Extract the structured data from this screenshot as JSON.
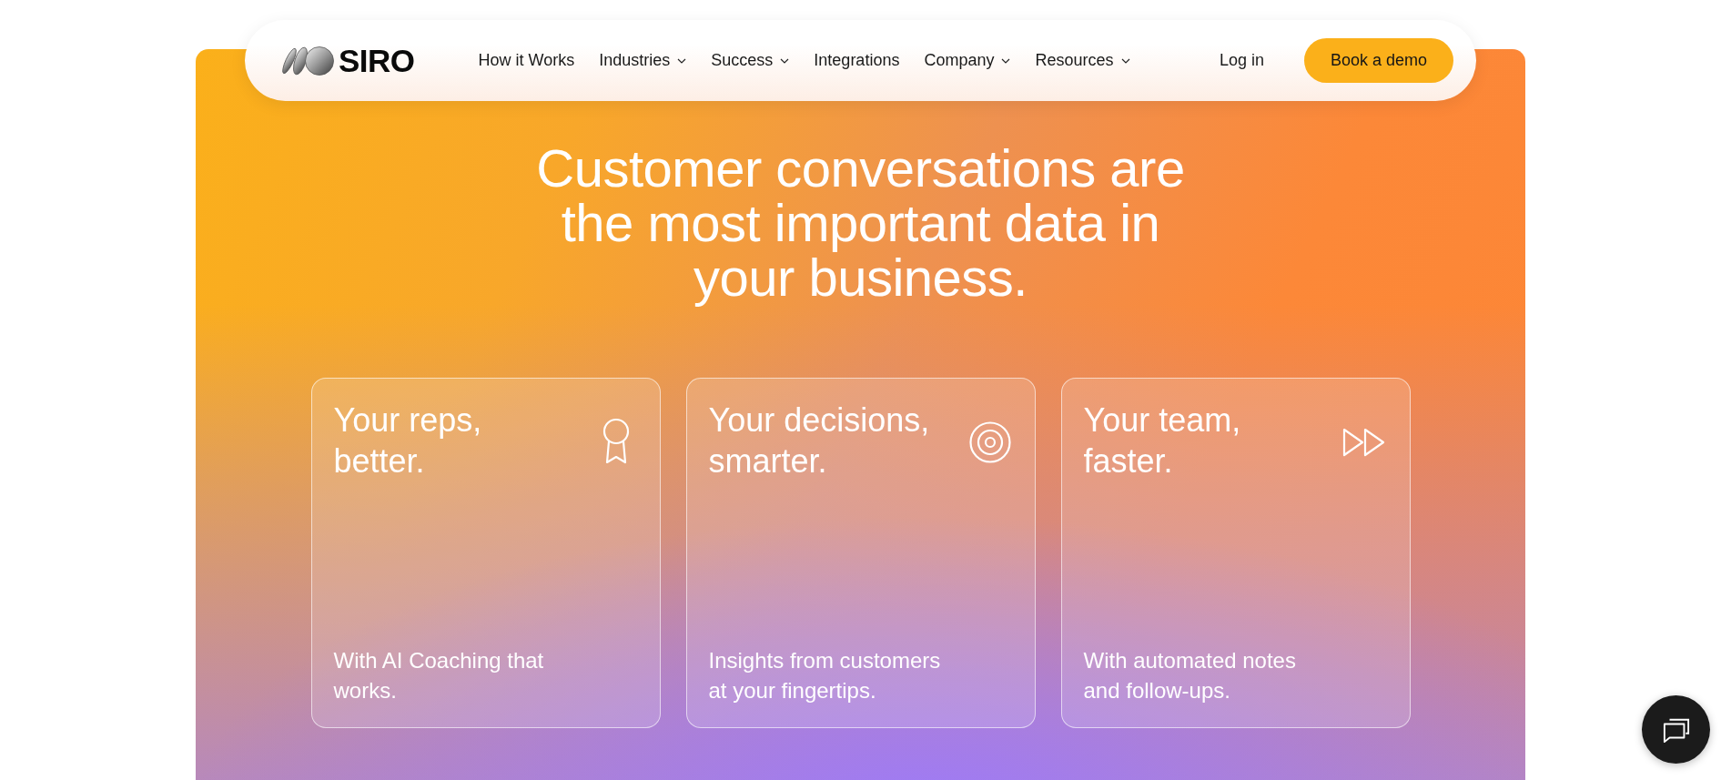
{
  "logo": {
    "text": "SIRO"
  },
  "nav": {
    "items": [
      {
        "label": "How it Works",
        "dropdown": false
      },
      {
        "label": "Industries",
        "dropdown": true
      },
      {
        "label": "Success",
        "dropdown": true
      },
      {
        "label": "Integrations",
        "dropdown": false
      },
      {
        "label": "Company",
        "dropdown": true
      },
      {
        "label": "Resources",
        "dropdown": true
      }
    ],
    "login": "Log in",
    "cta": "Book a demo"
  },
  "hero": {
    "headline": "Customer conversations are the most important data in your business."
  },
  "cards": [
    {
      "title": "Your reps, better.",
      "text": "With AI Coaching that works."
    },
    {
      "title": "Your decisions, smarter.",
      "text": "Insights from customers at your fingertips."
    },
    {
      "title": "Your team, faster.",
      "text": "With automated notes and follow-ups."
    }
  ]
}
